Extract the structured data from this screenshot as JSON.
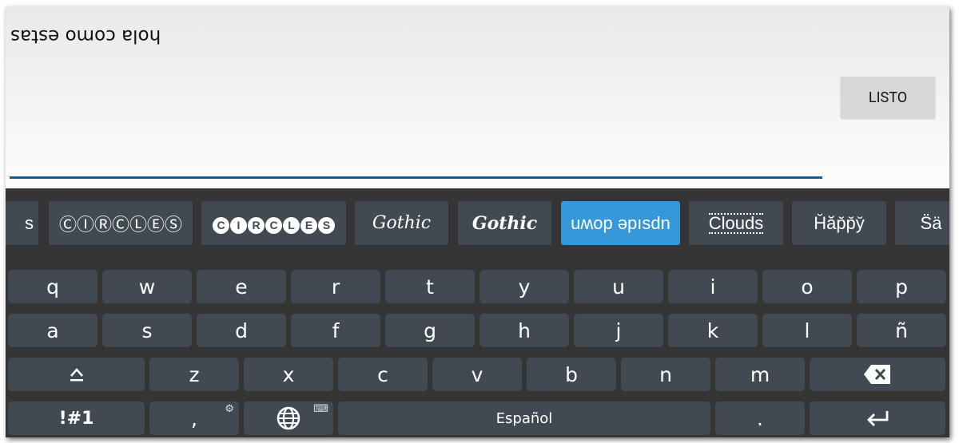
{
  "editor": {
    "text": "hola como estas",
    "done_button": "LISTO",
    "accent_color": "#1a5d86"
  },
  "suggestions": [
    {
      "label": "s"
    },
    {
      "label": "ⒸⒾⓇⒸⓁⒺⓈ"
    },
    {
      "label": "CIRCLES"
    },
    {
      "label": "Gothic"
    },
    {
      "label": "Gothic"
    },
    {
      "label": "uʍop ǝpısdn",
      "selected": true,
      "color": "#3498db"
    },
    {
      "label": "Clouds"
    },
    {
      "label": "H̆ăp̆p̆y̆"
    },
    {
      "label": "S̈ä"
    }
  ],
  "keyboard": {
    "row1": [
      "q",
      "w",
      "e",
      "r",
      "t",
      "y",
      "u",
      "i",
      "o",
      "p"
    ],
    "row2": [
      "a",
      "s",
      "d",
      "f",
      "g",
      "h",
      "j",
      "k",
      "l",
      "ñ"
    ],
    "row3": [
      "z",
      "x",
      "c",
      "v",
      "b",
      "n",
      "m"
    ],
    "shift_icon": "shift-icon",
    "backspace_icon": "backspace-icon",
    "symbols": "!#1",
    "comma": ",",
    "comma_sub_icon": "gear-icon",
    "globe_icon": "globe-icon",
    "globe_sub_icon": "keyboard-icon",
    "space": "Español",
    "period": ".",
    "enter_icon": "enter-icon"
  }
}
